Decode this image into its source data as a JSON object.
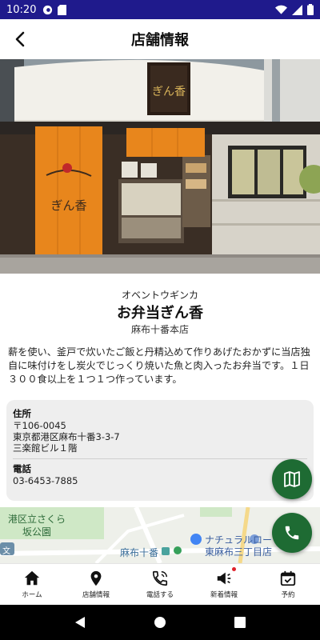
{
  "status_bar": {
    "time": "10:20"
  },
  "header": {
    "title": "店舗情報",
    "back_icon": "chevron-left-icon"
  },
  "shop": {
    "kana": "オベントウギンカ",
    "name": "お弁当ぎん香",
    "branch": "麻布十番本店",
    "description": "薪を使い、釜戸で炊いたご飯と丹精込めて作りあげたおかずに当店独自に味付けをし炭火でじっくり焼いた魚と肉入ったお弁当です。１日３００食以上を１つ１つ作っています。",
    "sign_text": "ぎん香",
    "noren_text": "ぎん香"
  },
  "info": {
    "address_label": "住所",
    "postal": "〒106-0045",
    "address_line1": "東京都港区麻布十番3-3-7",
    "address_line2": "三楽館ビル１階",
    "phone_label": "電話",
    "phone": "03-6453-7885"
  },
  "map": {
    "label_park1": "港区立さくら",
    "label_park2": "坂公園",
    "label_station": "麻布十番",
    "label_shop1": "ナチュラルロー",
    "label_shop2": "東麻布三丁目店",
    "label_bunkyo": "文"
  },
  "bottom_nav": {
    "items": [
      {
        "label": "ホーム",
        "icon": "home-icon"
      },
      {
        "label": "店舗情報",
        "icon": "location-pin-icon"
      },
      {
        "label": "電話する",
        "icon": "phone-call-icon"
      },
      {
        "label": "新着情報",
        "icon": "megaphone-icon"
      },
      {
        "label": "予約",
        "icon": "calendar-check-icon"
      }
    ]
  },
  "colors": {
    "status_bar": "#1f1a8c",
    "accent_green": "#1e6b33",
    "noren_orange": "#e8861c",
    "notification_red": "#e0202a"
  }
}
